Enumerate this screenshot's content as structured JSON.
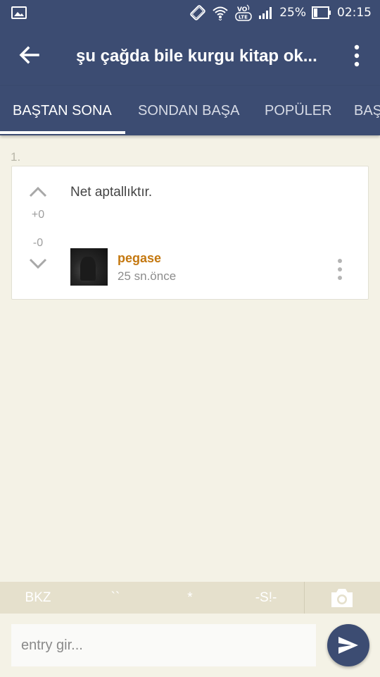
{
  "status_bar": {
    "battery": "25%",
    "time": "02:15",
    "volte": "VO\nLTE",
    "icons": [
      "image-icon",
      "rotate-icon",
      "wifi-icon",
      "volte-icon",
      "signal-icon",
      "battery-icon"
    ]
  },
  "app_bar": {
    "title": "şu çağda bile kurgu kitap ok...",
    "icons": [
      "back-arrow-icon",
      "more-vert-icon"
    ]
  },
  "tabs": [
    {
      "label": "BAŞTAN SONA",
      "active": true
    },
    {
      "label": "SONDAN BAŞA",
      "active": false
    },
    {
      "label": "POPÜLER",
      "active": false
    },
    {
      "label": "BAŞ",
      "active": false
    }
  ],
  "entry": {
    "number": "1.",
    "text": "Net aptallıktır.",
    "upvotes": "+0",
    "downvotes": "-0",
    "author": "pegase",
    "time": "25 sn.önce"
  },
  "format_bar": {
    "buttons": [
      "BKZ",
      "``",
      "*",
      "-S!-"
    ],
    "icon": "camera-icon"
  },
  "composer": {
    "placeholder": "entry gir...",
    "send_icon": "send-icon"
  },
  "colors": {
    "primary": "#3c4c72",
    "background": "#f4f2e6",
    "author": "#c47810",
    "toolbar": "#e5e0cc"
  }
}
